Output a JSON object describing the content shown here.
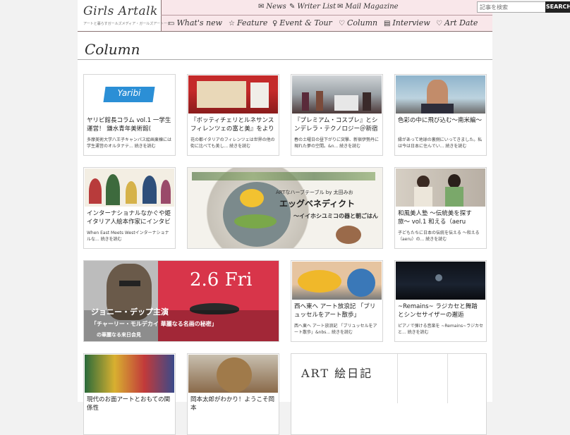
{
  "site": {
    "logo": "Girls Artalk",
    "tagline": "アートと暮らすガールズメディア・ガールズアートーク"
  },
  "topnav": [
    {
      "icon": "✉",
      "label": "News"
    },
    {
      "icon": "✎",
      "label": "Writer List"
    },
    {
      "icon": "✉",
      "label": "Mail Magazine"
    }
  ],
  "search": {
    "placeholder": "記事を検索",
    "button": "SEARCH"
  },
  "subnav": [
    {
      "icon": "▭",
      "label": "What's new"
    },
    {
      "icon": "☆",
      "label": "Feature"
    },
    {
      "icon": "♀",
      "label": "Event & Tour"
    },
    {
      "icon": "♡",
      "label": "Column"
    },
    {
      "icon": "▤",
      "label": "Interview"
    },
    {
      "icon": "♡",
      "label": "Art Date"
    }
  ],
  "section_title": "Column",
  "cards": [
    {
      "title": "ヤリビ館長コラム vol.1 一学生運営！ 鎌水青年美術館(",
      "desc": "多摩美術大学八王子キャンパス絵画東棟には学生運営のオルタナテ... 続きを読む",
      "thumb_text": "Yaribi"
    },
    {
      "title": "『ボッティチェリとルネサンス フィレンツェの富と美』をより楽",
      "desc": "花の都イタリアのフィレンツェは世界の他の街に比べても美し... 続きを読む"
    },
    {
      "title": "『プレミアム・コスプレ』とシンデレラ・テクノロジー＠新宿伊勢",
      "desc": "春の土曜日の昼下がりに突撃、新宿伊勢丹に現れた夢の空間。&n... 続きを読む"
    },
    {
      "title": "色彩の中に飛び込む〜南米編〜",
      "desc": "縁があって地球の裏側にいってきました。私は今は日本に住んでい... 続きを読む"
    },
    {
      "title": "インターナショナルなかぐや姫 イタリア人絵本作家にインタビュ",
      "desc": "When East Meets Westインターナショナルな... 続きを読む"
    },
    {
      "title": "ARTなハーブテーブル by 太田みお",
      "desc": "エッグベネディクト",
      "extra": "〜イイホシユミコの器と朝ごはん"
    },
    {
      "title": "和風美人塾 〜伝統美を探す旅〜 vol.1 和える（aeru",
      "desc": "子どもたちに日本の伝統を伝える 〜和える（aeru）の... 続きを読む"
    },
    {
      "title": "ジョニー・デップ主演",
      "desc": "「チャーリー・モルデカイ 華麗なる名画の秘密」",
      "extra": "の華麗なる来日会見",
      "date": "2.6 Fri"
    },
    {
      "title": "西へ東へ アート放浪記 「ブリュッセルをアート散歩」",
      "desc": "西へ東へ アート放浪記 「ブリュッセルをアート散歩」&nbs... 続きを読む"
    },
    {
      "title": "~Remains~ ラジカセと舞踏とシンセサイザーの邂逅",
      "desc": "ピアノで弾ける音楽を ~Remains~ラジカセと... 続きを読む"
    },
    {
      "title": "現代のお面アートとおもての関係性",
      "desc": ""
    },
    {
      "title": "岡本太郎がわかり！ようこそ岡本",
      "desc": ""
    },
    {
      "title": "ART 絵日記",
      "desc": ""
    }
  ],
  "colors": {
    "header_bg": "#f9e7ea",
    "accent": "#d6304a",
    "link": "#222222"
  }
}
